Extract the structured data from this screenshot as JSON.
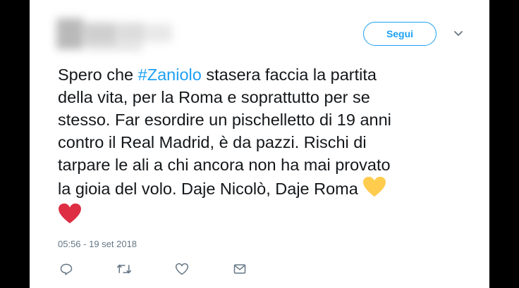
{
  "header": {
    "follow_label": "Segui",
    "more_icon": "chevron-down-icon"
  },
  "tweet": {
    "lines": [
      [
        "Spero che ",
        "#Zaniolo",
        " stasera faccia la partita"
      ],
      [
        "della vita, per la Roma e soprattutto per se"
      ],
      [
        "stesso. Far esordire un pischelletto di 19 anni"
      ],
      [
        "contro il Real Madrid, è da pazzi. Rischi di"
      ],
      [
        "tarpare le ali a chi ancora non ha mai provato"
      ],
      [
        "la gioia del volo. Daje Nicolò, Daje Roma "
      ]
    ],
    "emoji": [
      "yellow-heart-icon",
      "red-heart-icon"
    ],
    "timestamp": "05:56 - 19 set 2018"
  },
  "actions": [
    "reply-icon",
    "retweet-icon",
    "like-icon",
    "message-icon"
  ],
  "colors": {
    "accent": "#1da1f2",
    "text": "#14171a",
    "muted": "#657786",
    "yellow_heart": "#ffcc4d",
    "red_heart": "#dd2e44"
  }
}
